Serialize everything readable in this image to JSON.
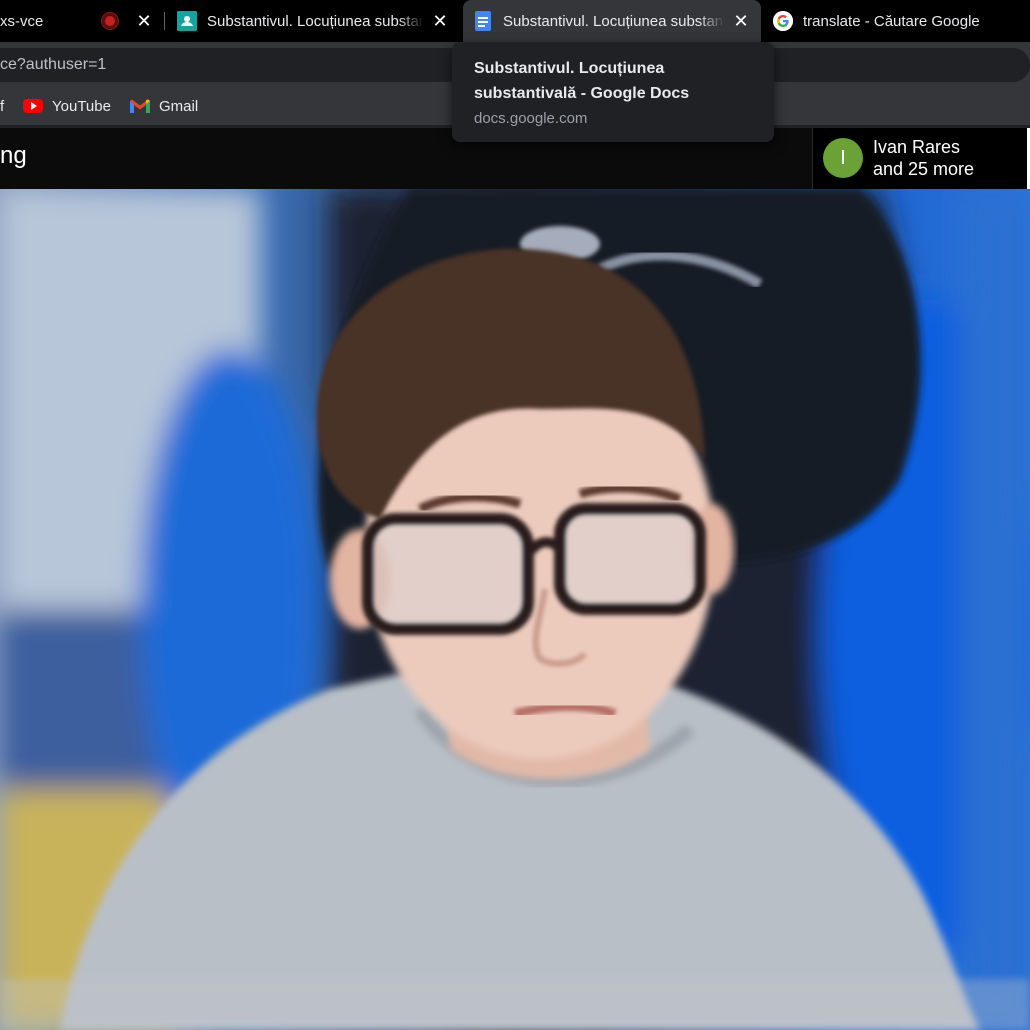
{
  "tabs": [
    {
      "title": "xs-vce",
      "recording": true,
      "active": false
    },
    {
      "title": "Substantivul. Locuțiunea substantivală",
      "favicon": "classroom-icon",
      "active": false
    },
    {
      "title": "Substantivul. Locuțiunea substantivală",
      "favicon": "google-docs-icon",
      "active": true
    },
    {
      "title": "translate - Căutare Google",
      "favicon": "google-icon",
      "active": false
    }
  ],
  "address_bar": {
    "url": "ce?authuser=1"
  },
  "bookmarks": [
    {
      "label": "YouTube",
      "icon": "youtube-icon"
    },
    {
      "label": "Gmail",
      "icon": "gmail-icon"
    }
  ],
  "meet": {
    "title": "ng",
    "participants": {
      "avatar_letter": "I",
      "name": "Ivan Rares",
      "more": "and 25 more",
      "avatar_color": "#6aa236"
    }
  },
  "tooltip": {
    "title": "Substantivul. Locuțiunea substantivală - Google Docs",
    "url": "docs.google.com"
  },
  "colors": {
    "tabstrip": "#000000",
    "active_tab": "#35363a",
    "record": "#c5221f",
    "docs_blue": "#4285f4"
  }
}
